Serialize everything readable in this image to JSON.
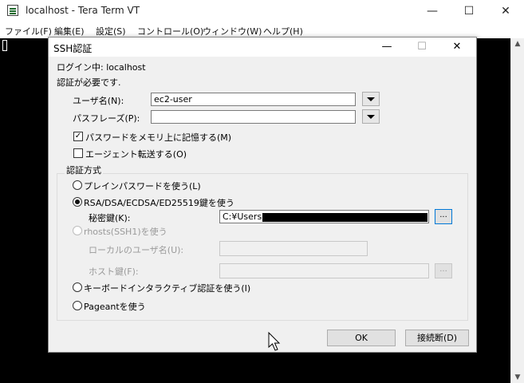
{
  "window": {
    "title": "localhost - Tera Term VT",
    "controls": {
      "minimize": "—",
      "maximize": "☐",
      "close": "✕"
    }
  },
  "menubar": {
    "items": [
      "ファイル(F)",
      "編集(E)",
      "設定(S)",
      "コントロール(O)",
      "ウィンドウ(W)",
      "ヘルプ(H)"
    ]
  },
  "dialog": {
    "title": "SSH認証",
    "controls": {
      "minimize": "—",
      "maximize": "☐",
      "close": "✕"
    },
    "login_line": "ログイン中: localhost",
    "auth_required": "認証が必要です.",
    "username_label": "ユーザ名(N):",
    "username_value": "ec2-user",
    "passphrase_label": "パスフレーズ(P):",
    "passphrase_value": "",
    "remember_password_label": "パスワードをメモリ上に記憶する(M)",
    "remember_password_checked": true,
    "agent_forwarding_label": "エージェント転送する(O)",
    "agent_forwarding_checked": false,
    "auth_method_group_label": "認証方式",
    "auth_methods": {
      "plain_password": "プレインパスワードを使う(L)",
      "rsa_key": "RSA/DSA/ECDSA/ED25519鍵を使う",
      "private_key_label": "秘密鍵(K):",
      "private_key_value": "C:¥Users¥",
      "rhosts": "rhosts(SSH1)を使う",
      "local_username_label": "ローカルのユーザ名(U):",
      "host_key_label": "ホスト鍵(F):",
      "keyboard_interactive": "キーボードインタラクティブ認証を使う(I)",
      "pageant": "Pageantを使う"
    },
    "selected_method": "rsa_key",
    "browse_label": "...",
    "ok_label": "OK",
    "disconnect_label": "接続断(D)"
  }
}
